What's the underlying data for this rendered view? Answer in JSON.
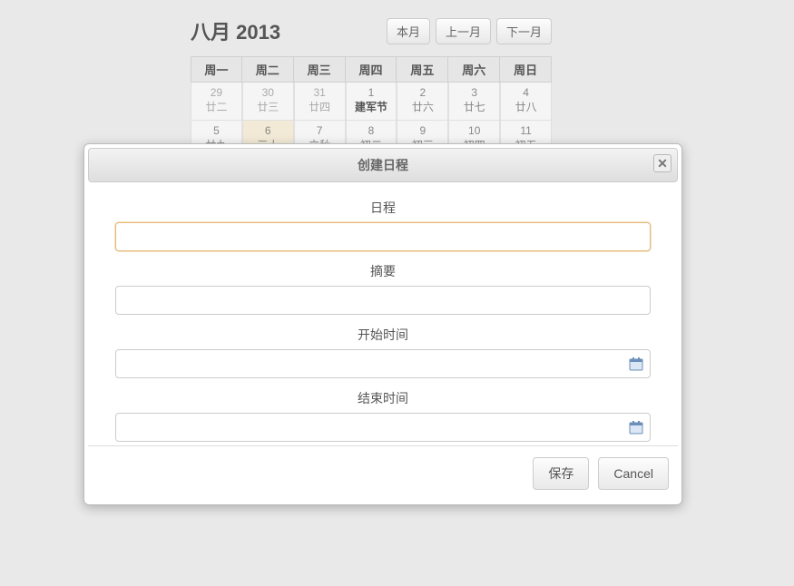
{
  "calendar": {
    "title": "八月 2013",
    "nav": {
      "this_month": "本月",
      "prev_month": "上一月",
      "next_month": "下一月"
    },
    "weekdays": [
      "周一",
      "周二",
      "周三",
      "周四",
      "周五",
      "周六",
      "周日"
    ],
    "rows": [
      [
        {
          "num": "29",
          "sub": "廿二",
          "other": true
        },
        {
          "num": "30",
          "sub": "廿三",
          "other": true
        },
        {
          "num": "31",
          "sub": "廿四",
          "other": true
        },
        {
          "num": "1",
          "sub": "建军节",
          "special": true
        },
        {
          "num": "2",
          "sub": "廿六"
        },
        {
          "num": "3",
          "sub": "廿七"
        },
        {
          "num": "4",
          "sub": "廿八"
        }
      ],
      [
        {
          "num": "5",
          "sub": "廿九"
        },
        {
          "num": "6",
          "sub": "三十",
          "today": true
        },
        {
          "num": "7",
          "sub": "立秋"
        },
        {
          "num": "8",
          "sub": "初二"
        },
        {
          "num": "9",
          "sub": "初三"
        },
        {
          "num": "10",
          "sub": "初四"
        },
        {
          "num": "11",
          "sub": "初五"
        }
      ]
    ]
  },
  "dialog": {
    "title": "创建日程",
    "fields": {
      "schedule": {
        "label": "日程",
        "value": ""
      },
      "summary": {
        "label": "摘要",
        "value": ""
      },
      "start": {
        "label": "开始时间",
        "value": ""
      },
      "end": {
        "label": "结束时间",
        "value": ""
      }
    },
    "buttons": {
      "save": "保存",
      "cancel": "Cancel"
    }
  }
}
